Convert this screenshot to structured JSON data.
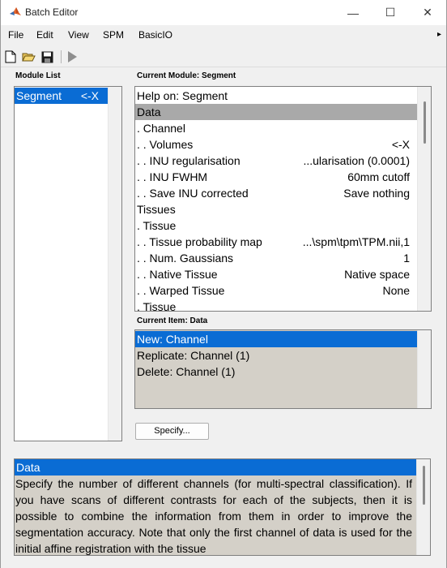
{
  "window": {
    "title": "Batch Editor",
    "minimize_glyph": "—",
    "maximize_glyph": "☐",
    "close_glyph": "✕"
  },
  "menu": {
    "items": [
      "File",
      "Edit",
      "View",
      "SPM",
      "BasicIO"
    ],
    "overflow_glyph": "▸"
  },
  "toolbar": {
    "icons": [
      "new-file-icon",
      "open-folder-icon",
      "save-icon",
      "run-icon"
    ]
  },
  "module_list": {
    "label": "Module List",
    "items": [
      {
        "label": "Segment",
        "value": "<-X",
        "selected": true
      }
    ]
  },
  "current_module": {
    "label": "Current Module: Segment",
    "rows": [
      {
        "label": "Help on: Segment",
        "value": "",
        "state": "normal"
      },
      {
        "label": "Data",
        "value": "",
        "state": "grey"
      },
      {
        "label": ". Channel",
        "value": "",
        "state": "normal"
      },
      {
        "label": ". . Volumes",
        "value": "<-X",
        "state": "normal"
      },
      {
        "label": ". . INU regularisation",
        "value": "...ularisation (0.0001)",
        "state": "normal"
      },
      {
        "label": ". . INU FWHM",
        "value": "60mm cutoff",
        "state": "normal"
      },
      {
        "label": ". . Save INU corrected",
        "value": "Save nothing",
        "state": "normal"
      },
      {
        "label": "Tissues",
        "value": "",
        "state": "normal"
      },
      {
        "label": ". Tissue",
        "value": "",
        "state": "normal"
      },
      {
        "label": ". . Tissue probability map",
        "value": "...\\spm\\tpm\\TPM.nii,1",
        "state": "normal"
      },
      {
        "label": ". . Num. Gaussians",
        "value": "1",
        "state": "normal"
      },
      {
        "label": ". . Native Tissue",
        "value": "Native space",
        "state": "normal"
      },
      {
        "label": ". . Warped Tissue",
        "value": "None",
        "state": "normal"
      },
      {
        "label": ". Tissue",
        "value": "",
        "state": "normal"
      }
    ]
  },
  "current_item": {
    "label": "Current Item: Data",
    "rows": [
      {
        "label": "New: Channel",
        "selected": true
      },
      {
        "label": "Replicate: Channel (1)",
        "selected": false
      },
      {
        "label": "Delete: Channel (1)",
        "selected": false
      }
    ]
  },
  "specify_button": "Specify...",
  "help": {
    "heading": "Data",
    "text": "Specify the number of different channels (for multi-spectral classification). If you have scans of different contrasts for each of the subjects, then it is possible to combine the information from them in order to improve the segmentation accuracy. Note that only the first channel of data is used for the initial affine registration with the tissue"
  },
  "colors": {
    "selection": "#0a6cd4",
    "grey_row": "#a9a9a9",
    "item_panel": "#d4d0c8"
  }
}
